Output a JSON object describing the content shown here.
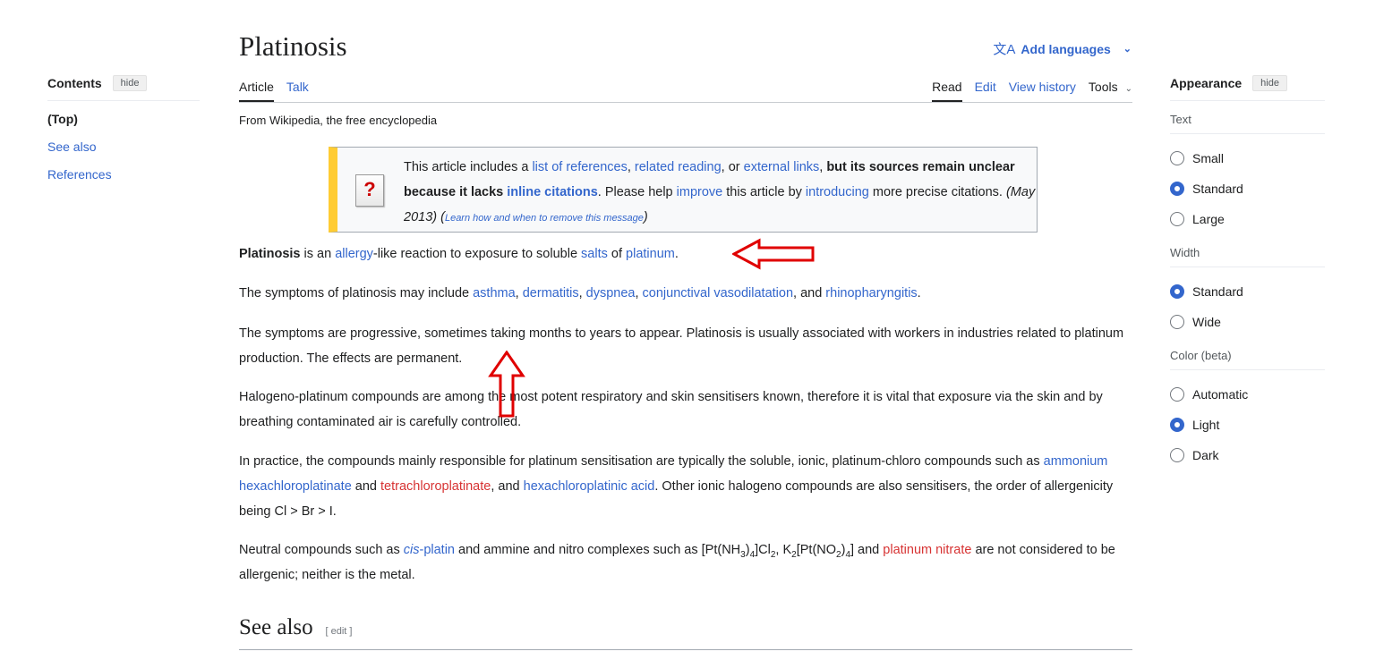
{
  "toc": {
    "title": "Contents",
    "hide": "hide",
    "items": [
      "(Top)",
      "See also",
      "References"
    ]
  },
  "article": {
    "title": "Platinosis",
    "add_languages": "Add languages",
    "tabs": {
      "article": "Article",
      "talk": "Talk",
      "read": "Read",
      "edit": "Edit",
      "history": "View history",
      "tools": "Tools"
    },
    "tagline": "From Wikipedia, the free encyclopedia"
  },
  "ambox": {
    "t1": "This article includes a ",
    "l1": "list of references",
    "t2": ", ",
    "l2": "related reading",
    "t3": ", or ",
    "l3": "external links",
    "t4": ", ",
    "b1": "but its sources remain unclear because it lacks ",
    "l4": "inline citations",
    "t5": ". Please help ",
    "l5": "improve",
    "t6": " this article by ",
    "l6": "introducing",
    "t7": " more precise citations. ",
    "date": "(May 2013)",
    "t8": " (",
    "l7": "Learn how and when to remove this message",
    "t9": ")"
  },
  "p1": {
    "bold": "Platinosis",
    "t1": " is an ",
    "l1": "allergy",
    "t2": "-like reaction to exposure to soluble ",
    "l2": "salts",
    "t3": " of ",
    "l3": "platinum",
    "t4": "."
  },
  "p2": {
    "t1": "The symptoms of platinosis may include ",
    "l1": "asthma",
    "t2": ", ",
    "l2": "dermatitis",
    "t3": ", ",
    "l3": "dyspnea",
    "t4": ", ",
    "l4": "conjunctival vasodilatation",
    "t5": ", and ",
    "l5": "rhinopharyngitis",
    "t6": "."
  },
  "p3": "The symptoms are progressive, sometimes taking months to years to appear. Platinosis is usually associated with workers in industries related to platinum production. The effects are permanent.",
  "p4": "Halogeno-platinum compounds are among the most potent respiratory and skin sensitisers known, therefore it is vital that exposure via the skin and by breathing contaminated air is carefully controlled.",
  "p5": {
    "t1": "In practice, the compounds mainly responsible for platinum sensitisation are typically the soluble, ionic, platinum-chloro compounds such as ",
    "l1": "ammonium hexachloroplatinate",
    "t2": " and ",
    "r1": "tetrachloroplatinate",
    "t3": ", and ",
    "l2": "hexachloroplatinic acid",
    "t4": ". Other ionic halogeno compounds are also sensitisers, the order of allergenicity being Cl > Br > I."
  },
  "p6": {
    "t1": "Neutral compounds such as ",
    "l1a": "cis",
    "l1b": "-platin",
    "t2": " and ammine and nitro complexes such as [Pt(NH",
    "s1": "3",
    "t3": ")",
    "s2": "4",
    "t4": "]Cl",
    "s3": "2",
    "t5": ", K",
    "s4": "2",
    "t6": "[Pt(NO",
    "s5": "2",
    "t7": ")",
    "s6": "4",
    "t8": "] and ",
    "r1": "platinum nitrate",
    "t9": " are not considered to be allergenic; neither is the metal."
  },
  "see_also": {
    "title": "See also",
    "edit": "[ edit ]"
  },
  "appearance": {
    "title": "Appearance",
    "hide": "hide",
    "text_label": "Text",
    "text_opts": [
      {
        "label": "Small",
        "on": false
      },
      {
        "label": "Standard",
        "on": true
      },
      {
        "label": "Large",
        "on": false
      }
    ],
    "width_label": "Width",
    "width_opts": [
      {
        "label": "Standard",
        "on": true
      },
      {
        "label": "Wide",
        "on": false
      }
    ],
    "color_label": "Color (beta)",
    "color_opts": [
      {
        "label": "Automatic",
        "on": false
      },
      {
        "label": "Light",
        "on": true
      },
      {
        "label": "Dark",
        "on": false
      }
    ]
  },
  "colors": {
    "link": "#3366cc",
    "redlink": "#d73333",
    "accent_arrow": "#e00000",
    "ambox_stripe": "#ffcc33"
  }
}
